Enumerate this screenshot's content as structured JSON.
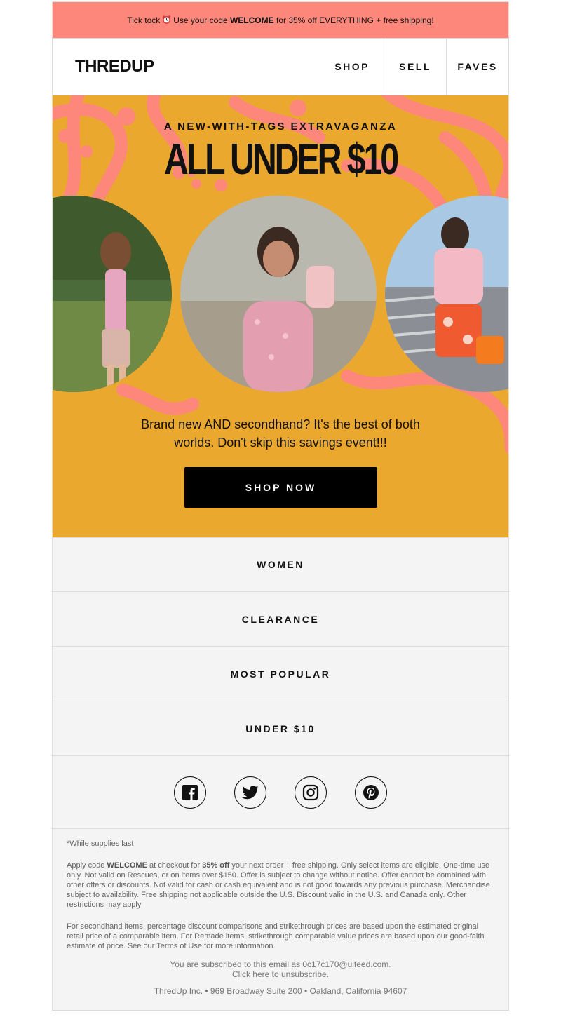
{
  "banner": {
    "prefix": "Tick tock",
    "clock_icon": "alarm-clock-icon",
    "mid": "Use your code",
    "code": "WELCOME",
    "suffix": "for 35% off EVERYTHING + free shipping!"
  },
  "header": {
    "logo": "THREDUP",
    "nav": [
      "SHOP",
      "SELL",
      "FAVES"
    ]
  },
  "hero": {
    "eyebrow": "A NEW-WITH-TAGS EXTRAVAGANZA",
    "headline": "ALL UNDER $10",
    "blurb": "Brand new AND secondhand? It's the best of both worlds. Don't skip this savings event!!!",
    "cta": "SHOP NOW",
    "colors": {
      "background": "#eba82f",
      "swirl": "#fc877a"
    }
  },
  "categories": [
    "WOMEN",
    "CLEARANCE",
    "MOST POPULAR",
    "UNDER $10"
  ],
  "social": [
    "facebook-icon",
    "twitter-icon",
    "instagram-icon",
    "pinterest-icon"
  ],
  "legal": {
    "supplies": "*While supplies last",
    "p1_a": "Apply code ",
    "p1_code": "WELCOME",
    "p1_b": " at checkout for ",
    "p1_pct": "35% off",
    "p1_c": " your next order + free shipping. Only select items are eligible. One-time use only. Not valid on Rescues, or on items over $150. Offer is subject to change without notice. Offer cannot be combined with other offers or discounts. Not valid for cash or cash equivalent and is not good towards any previous purchase. Merchandise subject to availability. Free shipping not applicable outside the U.S. Discount valid in the U.S. and Canada only. Other restrictions may apply",
    "p2": "For secondhand items, percentage discount comparisons and strikethrough prices are based upon the estimated original retail price of a comparable item. For Remade items, strikethrough comparable value prices are based upon our good-faith estimate of price. See our Terms of Use for more information.",
    "subscribed": "You are subscribed to this email as 0c17c170@uifeed.com.",
    "unsubscribe": "Click here to unsubscribe.",
    "address": "ThredUp Inc. • 969 Broadway Suite 200 • Oakland, California 94607"
  }
}
